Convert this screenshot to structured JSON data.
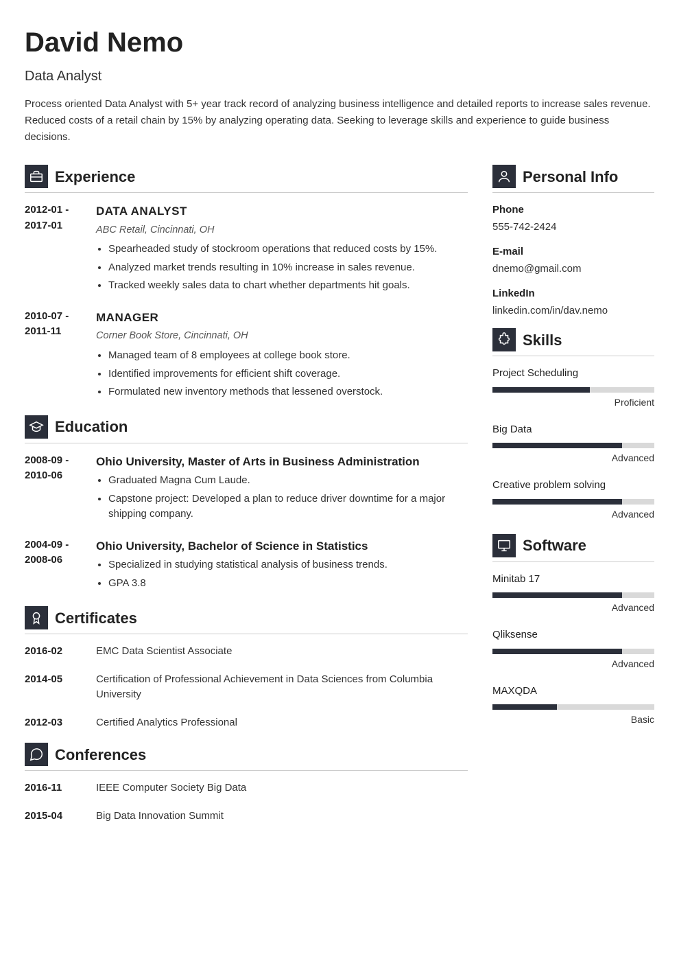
{
  "header": {
    "name": "David Nemo",
    "title": "Data Analyst",
    "summary": "Process oriented Data Analyst with 5+ year track record of analyzing business intelligence and detailed reports to increase sales revenue. Reduced costs of a retail chain by 15% by analyzing operating data. Seeking to leverage skills and experience to guide business decisions."
  },
  "sections": {
    "experience_title": "Experience",
    "education_title": "Education",
    "certificates_title": "Certificates",
    "conferences_title": "Conferences",
    "personal_info_title": "Personal Info",
    "skills_title": "Skills",
    "software_title": "Software"
  },
  "experience": [
    {
      "dates": "2012-01 - 2017-01",
      "role": "DATA ANALYST",
      "company": "ABC Retail, Cincinnati, OH",
      "bullets": [
        "Spearheaded study of stockroom operations that reduced costs by 15%.",
        "Analyzed market trends resulting in 10% increase in sales revenue.",
        "Tracked weekly sales data to chart whether departments hit goals."
      ]
    },
    {
      "dates": "2010-07 - 2011-11",
      "role": "MANAGER",
      "company": "Corner Book Store, Cincinnati, OH",
      "bullets": [
        "Managed team of 8 employees at college book store.",
        "Identified improvements for efficient shift coverage.",
        "Formulated new inventory methods that lessened overstock."
      ]
    }
  ],
  "education": [
    {
      "dates": "2008-09 - 2010-06",
      "school": "Ohio University, Master of Arts in Business Administration",
      "bullets": [
        "Graduated Magna Cum Laude.",
        "Capstone project: Developed a plan to reduce driver downtime for a major shipping company."
      ]
    },
    {
      "dates": "2004-09 - 2008-06",
      "school": "Ohio University, Bachelor of Science in Statistics",
      "bullets": [
        "Specialized in studying statistical analysis of business trends.",
        "GPA 3.8"
      ]
    }
  ],
  "certificates": [
    {
      "dates": "2016-02",
      "text": "EMC Data Scientist Associate"
    },
    {
      "dates": "2014-05",
      "text": "Certification of Professional Achievement in Data Sciences from Columbia University"
    },
    {
      "dates": "2012-03",
      "text": "Certified Analytics Professional"
    }
  ],
  "conferences": [
    {
      "dates": "2016-11",
      "text": "IEEE Computer Society Big Data"
    },
    {
      "dates": "2015-04",
      "text": "Big Data Innovation Summit"
    }
  ],
  "personal_info": {
    "phone_label": "Phone",
    "phone": "555-742-2424",
    "email_label": "E-mail",
    "email": "dnemo@gmail.com",
    "linkedin_label": "LinkedIn",
    "linkedin": "linkedin.com/in/dav.nemo"
  },
  "skills": [
    {
      "name": "Project Scheduling",
      "level": "Proficient",
      "pct": 60
    },
    {
      "name": "Big Data",
      "level": "Advanced",
      "pct": 80
    },
    {
      "name": "Creative problem solving",
      "level": "Advanced",
      "pct": 80
    }
  ],
  "software": [
    {
      "name": "Minitab 17",
      "level": "Advanced",
      "pct": 80
    },
    {
      "name": "Qliksense",
      "level": "Advanced",
      "pct": 80
    },
    {
      "name": "MAXQDA",
      "level": "Basic",
      "pct": 40
    }
  ]
}
